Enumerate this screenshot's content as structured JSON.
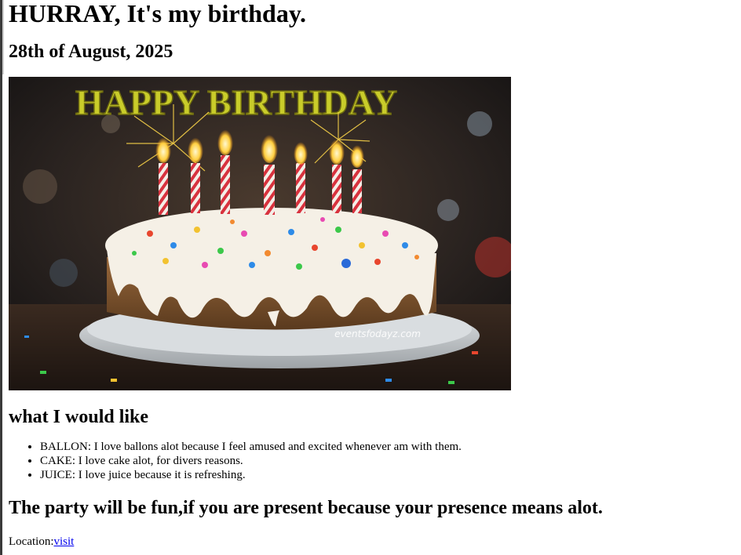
{
  "heading": "HURRAY, It's my birthday.",
  "date": "28th of August, 2025",
  "image": {
    "banner_text": "HAPPY BIRTHDAY",
    "watermark": "eventsfodayz.com",
    "colors": {
      "banner": "#c9cc2a",
      "icing": "#f5f0e6",
      "cake": "#8a5a32",
      "plate": "#cfd3d6"
    }
  },
  "wishlist": {
    "title": "what I would like",
    "items": [
      "BALLON: I love ballons alot because I feel amused and excited whenever am with them.",
      "CAKE: I love cake alot, for divers reasons.",
      "JUICE: I love juice because it is refreshing."
    ]
  },
  "party_message": "The party will be fun,if you are present because your presence means alot.",
  "location": {
    "label": "Location:",
    "link_text": "visit"
  },
  "colors": {
    "link": "#0000ee"
  }
}
